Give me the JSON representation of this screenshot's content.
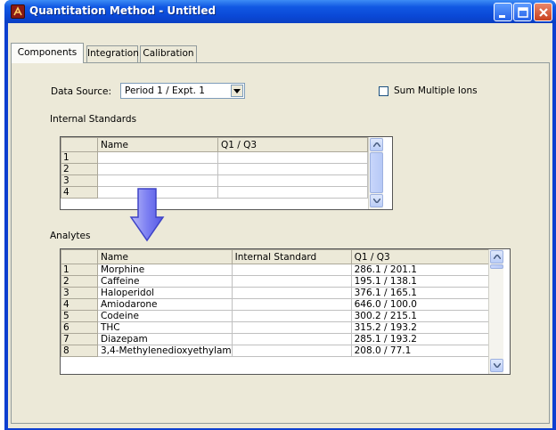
{
  "window": {
    "title": "Quantitation Method - Untitled",
    "title_bar_color": "#0a48d6"
  },
  "tabs": [
    {
      "label": "Components",
      "active": true
    },
    {
      "label": "Integration",
      "active": false
    },
    {
      "label": "Calibration",
      "active": false
    }
  ],
  "data_source": {
    "label": "Data Source:",
    "value": "Period 1 / Expt. 1"
  },
  "sum_multiple_ions": {
    "label": "Sum Multiple Ions",
    "checked": false
  },
  "internal_standards": {
    "heading": "Internal Standards",
    "columns": [
      "Name",
      "Q1 / Q3"
    ],
    "rows": [
      {
        "num": "1",
        "name": "",
        "q": ""
      },
      {
        "num": "2",
        "name": "",
        "q": ""
      },
      {
        "num": "3",
        "name": "",
        "q": ""
      },
      {
        "num": "4",
        "name": "",
        "q": ""
      }
    ]
  },
  "analytes": {
    "heading": "Analytes",
    "columns": [
      "Name",
      "Internal Standard",
      "Q1 / Q3"
    ],
    "rows": [
      {
        "num": "1",
        "name": "Morphine",
        "is": "",
        "q": "286.1 / 201.1"
      },
      {
        "num": "2",
        "name": "Caffeine",
        "is": "",
        "q": "195.1 / 138.1"
      },
      {
        "num": "3",
        "name": "Haloperidol",
        "is": "",
        "q": "376.1 / 165.1"
      },
      {
        "num": "4",
        "name": "Amiodarone",
        "is": "",
        "q": "646.0 / 100.0"
      },
      {
        "num": "5",
        "name": "Codeine",
        "is": "",
        "q": "300.2 / 215.1"
      },
      {
        "num": "6",
        "name": "THC",
        "is": "",
        "q": "315.2 / 193.2"
      },
      {
        "num": "7",
        "name": "Diazepam",
        "is": "",
        "q": "285.1 / 193.2"
      },
      {
        "num": "8",
        "name": "3,4-Methylenedioxyethylam",
        "is": "",
        "q": "208.0 / 77.1"
      }
    ]
  },
  "annotation_arrow_color": "#6a6ef0"
}
